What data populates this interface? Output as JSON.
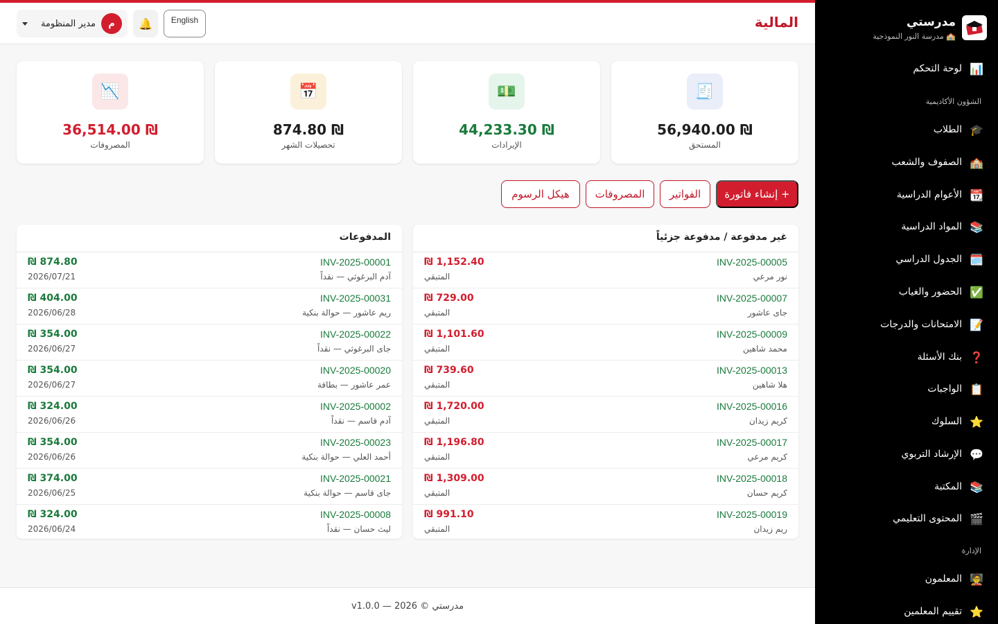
{
  "brand": {
    "name": "مدرستي",
    "school": "🏫 مدرسة النور النموذجية"
  },
  "sidebar": {
    "dashboard": "لوحة التحكم",
    "section_academic": "الشؤون الأكاديمية",
    "items": [
      {
        "label": "الطلاب",
        "icon": "🎓"
      },
      {
        "label": "الصفوف والشعب",
        "icon": "🏫"
      },
      {
        "label": "الأعوام الدراسية",
        "icon": "📆"
      },
      {
        "label": "المواد الدراسية",
        "icon": "📚"
      },
      {
        "label": "الجدول الدراسي",
        "icon": "🗓️"
      },
      {
        "label": "الحضور والغياب",
        "icon": "✅"
      },
      {
        "label": "الامتحانات والدرجات",
        "icon": "📝"
      },
      {
        "label": "بنك الأسئلة",
        "icon": "❓"
      },
      {
        "label": "الواجبات",
        "icon": "📋"
      },
      {
        "label": "السلوك",
        "icon": "⭐"
      },
      {
        "label": "الإرشاد التربوي",
        "icon": "💬"
      },
      {
        "label": "المكتبة",
        "icon": "📚"
      },
      {
        "label": "المحتوى التعليمي",
        "icon": "🎬"
      }
    ],
    "section_admin": "الإدارة",
    "admin_items": [
      {
        "label": "المعلمون",
        "icon": "🧑‍🏫"
      },
      {
        "label": "تقييم المعلمين",
        "icon": "⭐"
      }
    ],
    "dashboard_icon": "📊"
  },
  "header": {
    "title": "المالية",
    "lang_button": "English",
    "bell_icon": "🔔",
    "user_initial": "م",
    "user_name": "مدير المنظومة"
  },
  "stats": [
    {
      "label": "المستحق",
      "value": "₪ 56,940.00",
      "icon": "🧾",
      "color": "#1e1e1e",
      "bg": "#e9eef9"
    },
    {
      "label": "الإيرادات",
      "value": "₪ 44,233.30",
      "icon": "💵",
      "color": "#1a7a3c",
      "bg": "#e6f5ec"
    },
    {
      "label": "تحصيلات الشهر",
      "value": "₪ 874.80",
      "icon": "📅",
      "color": "#1e1e1e",
      "bg": "#fbf1da"
    },
    {
      "label": "المصروفات",
      "value": "₪ 36,514.00",
      "icon": "📉",
      "color": "#d21d2e",
      "bg": "#fbe7e7"
    }
  ],
  "actions": {
    "create_invoice": "+ إنشاء فاتورة",
    "invoices": "الفواتير",
    "expenses": "المصروفات",
    "fee_structure": "هيكل الرسوم"
  },
  "unpaid": {
    "title": "غير مدفوعة / مدفوعة جزئياً",
    "remaining_label": "المتبقي",
    "rows": [
      {
        "invoice": "INV-2025-00005",
        "student": "نور مرعي",
        "amount": "₪ 1,152.40"
      },
      {
        "invoice": "INV-2025-00007",
        "student": "جاى عاشور",
        "amount": "₪ 729.00"
      },
      {
        "invoice": "INV-2025-00009",
        "student": "محمد شاهين",
        "amount": "₪ 1,101.60"
      },
      {
        "invoice": "INV-2025-00013",
        "student": "هلا شاهين",
        "amount": "₪ 739.60"
      },
      {
        "invoice": "INV-2025-00016",
        "student": "كريم زيدان",
        "amount": "₪ 1,720.00"
      },
      {
        "invoice": "INV-2025-00017",
        "student": "كريم مرعي",
        "amount": "₪ 1,196.80"
      },
      {
        "invoice": "INV-2025-00018",
        "student": "كريم حسان",
        "amount": "₪ 1,309.00"
      },
      {
        "invoice": "INV-2025-00019",
        "student": "ريم زيدان",
        "amount": "₪ 991.10"
      }
    ]
  },
  "payments": {
    "title": "المدفوعات",
    "rows": [
      {
        "invoice": "INV-2025-00001",
        "detail": "آدم البرغوثي — نقداً",
        "amount": "₪ 874.80",
        "date": "2026/07/21"
      },
      {
        "invoice": "INV-2025-00031",
        "detail": "ريم عاشور — حوالة بنكية",
        "amount": "₪ 404.00",
        "date": "2026/06/28"
      },
      {
        "invoice": "INV-2025-00022",
        "detail": "جاى البرغوثي — نقداً",
        "amount": "₪ 354.00",
        "date": "2026/06/27"
      },
      {
        "invoice": "INV-2025-00020",
        "detail": "عمر عاشور — بطاقة",
        "amount": "₪ 354.00",
        "date": "2026/06/27"
      },
      {
        "invoice": "INV-2025-00002",
        "detail": "آدم قاسم — نقداً",
        "amount": "₪ 324.00",
        "date": "2026/06/26"
      },
      {
        "invoice": "INV-2025-00023",
        "detail": "أحمد العلي — حوالة بنكية",
        "amount": "₪ 354.00",
        "date": "2026/06/26"
      },
      {
        "invoice": "INV-2025-00021",
        "detail": "جاى قاسم — حوالة بنكية",
        "amount": "₪ 374.00",
        "date": "2026/06/25"
      },
      {
        "invoice": "INV-2025-00008",
        "detail": "ليث حسان — نقداً",
        "amount": "₪ 324.00",
        "date": "2026/06/24"
      }
    ]
  },
  "footer": {
    "text": "مدرستي © 2026 — v1.0.0"
  }
}
